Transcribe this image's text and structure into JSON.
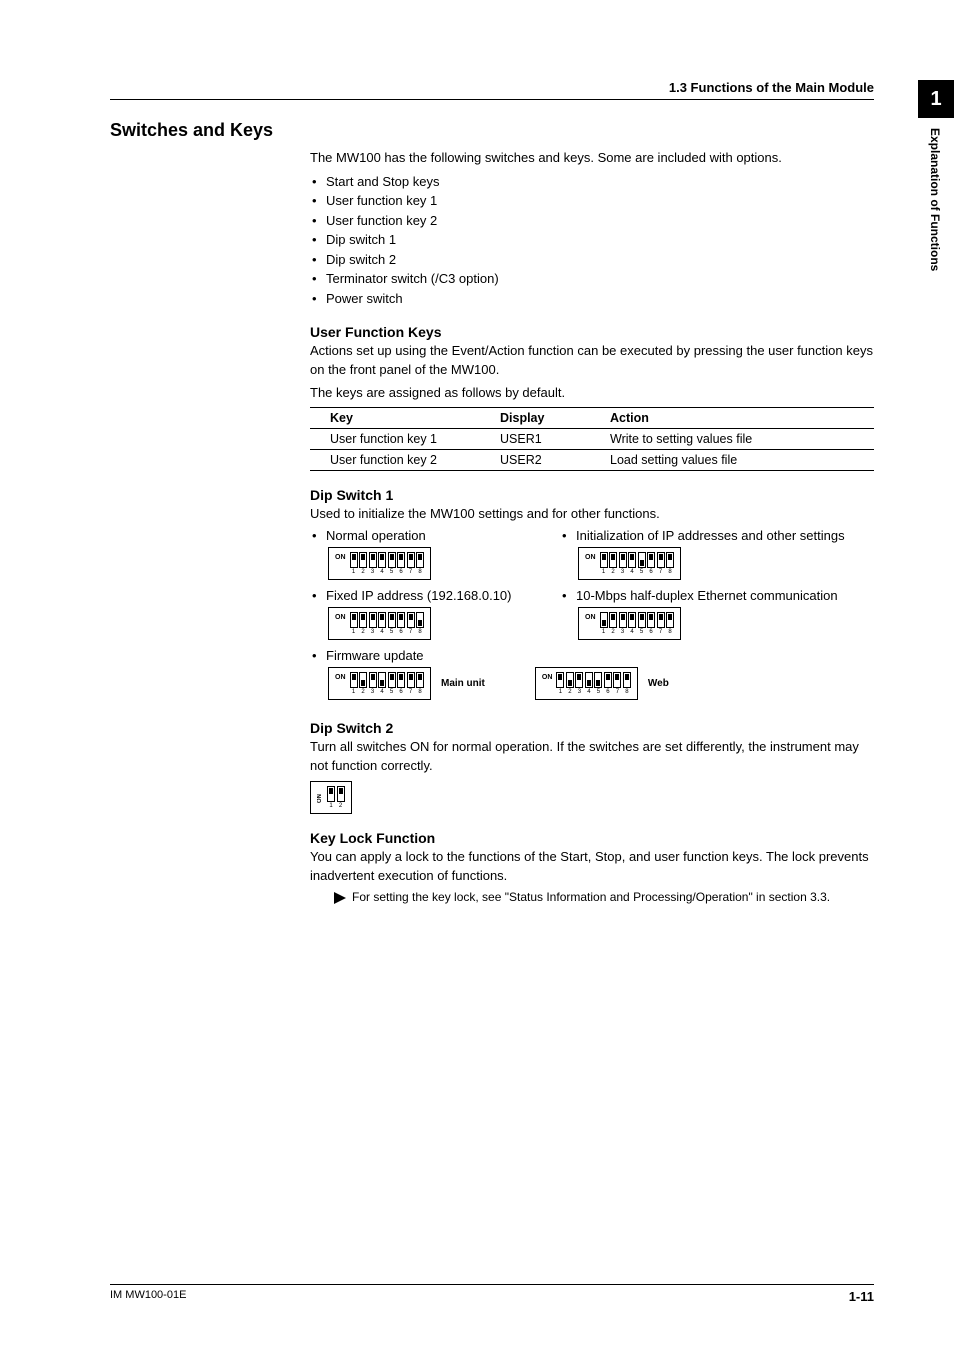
{
  "side_tab": {
    "number": "1",
    "label": "Explanation of Functions"
  },
  "header": {
    "section_ref": "1.3  Functions of the Main Module"
  },
  "section_title": "Switches and Keys",
  "intro": "The MW100 has the following switches and keys. Some are included with options.",
  "switch_list": [
    "Start and Stop keys",
    "User function key 1",
    "User function key 2",
    "Dip switch 1",
    "Dip switch 2",
    "Terminator switch (/C3 option)",
    "Power switch"
  ],
  "ufk": {
    "heading": "User Function Keys",
    "para1": "Actions set up using the Event/Action function can be executed by pressing the user function keys on the front panel of the MW100.",
    "para2": "The keys are assigned as follows by default.",
    "cols": {
      "c1": "Key",
      "c2": "Display",
      "c3": "Action"
    },
    "rows": [
      {
        "key": "User function key 1",
        "display": "USER1",
        "action": "Write to setting values file"
      },
      {
        "key": "User function key 2",
        "display": "USER2",
        "action": "Load setting values file"
      }
    ]
  },
  "dip1": {
    "heading": "Dip Switch 1",
    "para": "Used to initialize the MW100 settings and for other functions.",
    "on": "ON",
    "items": {
      "normal": {
        "label": "Normal operation",
        "pattern": "11111111"
      },
      "init": {
        "label": "Initialization of IP addresses and other settings",
        "pattern": "11110111"
      },
      "fixed": {
        "label": "Fixed IP address (192.168.0.10)",
        "pattern": "11111110"
      },
      "tenm": {
        "label": "10-Mbps half-duplex Ethernet communication",
        "pattern": "01111111"
      },
      "fw": {
        "label": "Firmware update",
        "main_pattern": "10101111",
        "main_label": "Main unit",
        "web_pattern": "10100111",
        "web_label": "Web"
      }
    }
  },
  "dip2": {
    "heading": "Dip Switch 2",
    "para": "Turn all switches ON for normal operation. If the switches are set differently, the instrument may not function correctly.",
    "on": "ON",
    "pattern": "11"
  },
  "keylock": {
    "heading": "Key Lock Function",
    "para": "You can apply a lock to the functions of the Start, Stop, and user function keys. The lock prevents inadvertent execution of functions.",
    "note": "For setting the key lock, see \"Status Information and Processing/Operation\" in section 3.3."
  },
  "footer": {
    "left": "IM MW100-01E",
    "right": "1-11"
  }
}
